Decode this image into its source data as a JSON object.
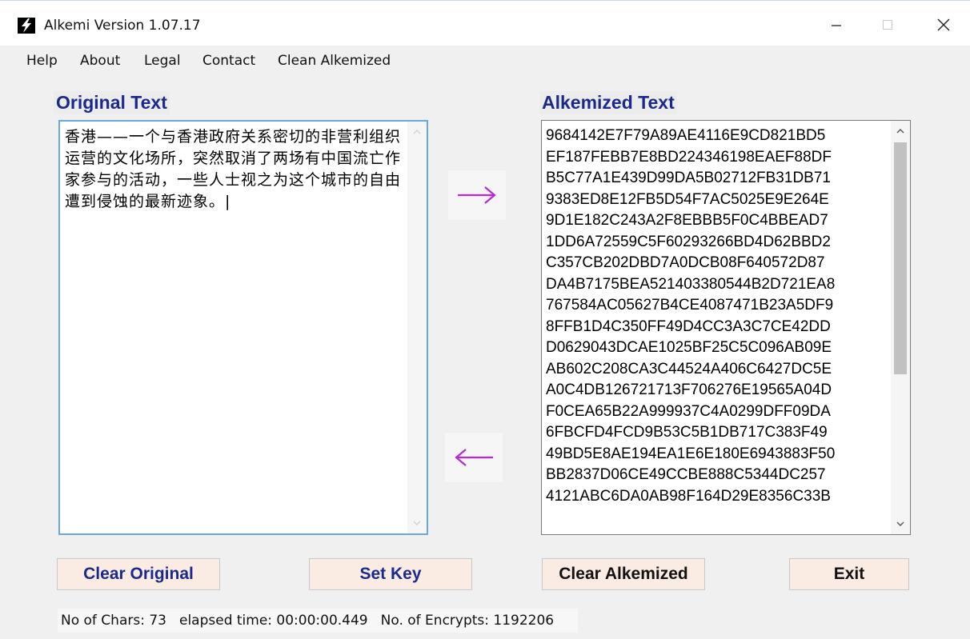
{
  "window": {
    "title": "Alkemi Version 1.07.17"
  },
  "menu": {
    "items": [
      "Help",
      "About",
      "Legal",
      "Contact",
      "Clean Alkemized"
    ]
  },
  "original": {
    "label": "Original Text",
    "text": "香港——一个与香港政府关系密切的非营利组织运营的文化场所，突然取消了两场有中国流亡作家参与的活动，一些人士视之为这个城市的自由遭到侵蚀的最新迹象。|"
  },
  "alkemized": {
    "label": "Alkemized Text",
    "lines": [
      "9684142E7F79A89AE4116E9CD821BD5",
      "EF187FEBB7E8BD224346198EAEF88DF",
      "B5C77A1E439D99DA5B02712FB31DB71",
      "9383ED8E12FB5D54F7AC5025E9E264E",
      "9D1E182C243A2F8EBBB5F0C4BBEAD7",
      "1DD6A72559C5F60293266BD4D62BBD2",
      "C357CB202DBD7A0DCB08F640572D87",
      "DA4B7175BEA521403380544B2D721EA8",
      "767584AC05627B4CE4087471B23A5DF9",
      "8FFB1D4C350FF49D4CC3A3C7CE42DD",
      "D0629043DCAE1025BF25C5C096AB09E",
      "AB602C208CA3C44524A406C6427DC5E",
      "A0C4DB126721713F706276E19565A04D",
      "F0CEA65B22A999937C4A0299DFF09DA",
      "6FBCFD4FCD9B53C5B1DB717C383F49",
      "49BD5E8AE194EA1E6E180E6943883F50",
      "BB2837D06CE49CCBE888C5344DC257",
      "4121ABC6DA0AB98F164D29E8356C33B"
    ]
  },
  "arrows": {
    "encrypt": "→",
    "decrypt": "←",
    "color": "#b52ad6"
  },
  "buttons": {
    "clear_original": "Clear Original",
    "set_key": "Set Key",
    "clear_alkemized": "Clear Alkemized",
    "exit": "Exit"
  },
  "status": {
    "chars": "No of Chars: 73",
    "elapsed": "elapsed time: 00:00:00.449",
    "encrypts": "No. of Encrypts: 1192206"
  }
}
